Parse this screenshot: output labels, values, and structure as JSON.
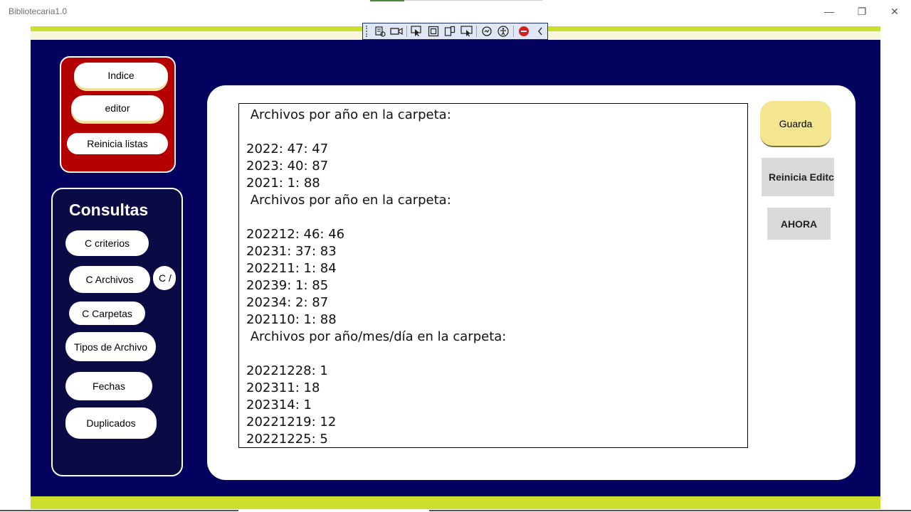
{
  "window": {
    "title": "Bibliotecaria1.0",
    "minimize_glyph": "—",
    "maximize_glyph": "❐",
    "close_glyph": "✕"
  },
  "debug_toolbar": {
    "icons": [
      "live-visual-tree-icon",
      "record-icon",
      "select-element-icon",
      "display-layout-adorners-icon",
      "track-focus-icon",
      "display-layout-icon",
      "hot-reload-icon",
      "accessibility-icon",
      "stop-icon",
      "collapse-icon"
    ]
  },
  "nav": {
    "indice_label": "Indice",
    "editor_label": "editor",
    "reinicia_listas_label": "Reinicia listas"
  },
  "consultas": {
    "title": "Consultas",
    "c_criterios_label": "C criterios",
    "c_archivos_label": "C Archivos",
    "c_a_label": "C /",
    "c_carpetas_label": "C Carpetas",
    "tipos_label": "Tipos de Archivo",
    "fechas_label": "Fechas",
    "duplicados_label": "Duplicados"
  },
  "editor": {
    "lines": [
      " Archivos por año en la carpeta:",
      "",
      "2022: 47: 47",
      "2023: 40: 87",
      "2021: 1: 88",
      " Archivos por año en la carpeta:",
      "",
      "202212: 46: 46",
      "20231: 37: 83",
      "202211: 1: 84",
      "20239: 1: 85",
      "20234: 2: 87",
      "202110: 1: 88",
      " Archivos por año/mes/día en la carpeta:",
      "",
      "20221228: 1",
      "202311: 18",
      "202314: 1",
      "20221219: 12",
      "20221225: 5"
    ]
  },
  "actions": {
    "guarda_label": "Guarda",
    "reinicia_editor_label": "Reinicia Editc",
    "ahora_label": "AHORA"
  },
  "colors": {
    "navy": "#03035f",
    "lime": "#cddf2e",
    "nav_red": "#b40000",
    "guarda_yellow": "#f4e691"
  }
}
